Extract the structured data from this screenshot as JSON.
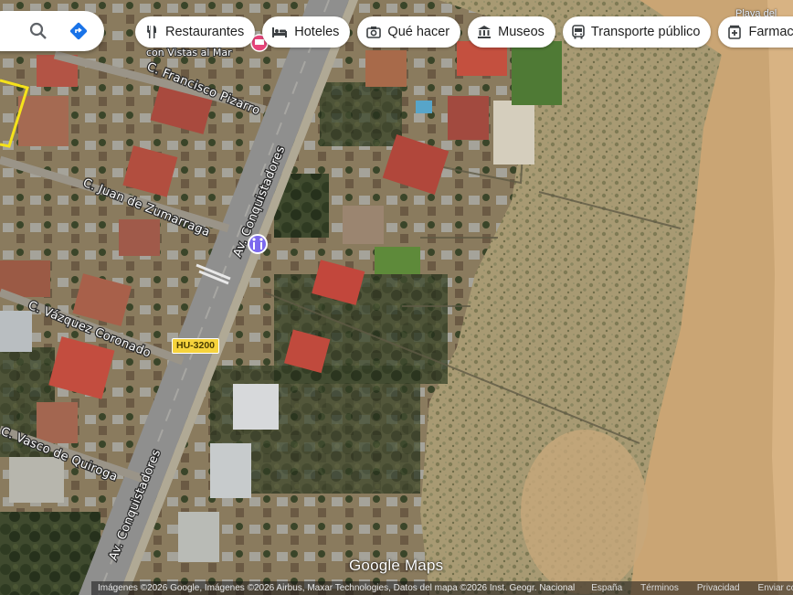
{
  "search": {
    "search_icon": "search-icon",
    "directions_icon": "directions-icon",
    "accent": "#1a73e8"
  },
  "chips": [
    {
      "label": "Restaurantes",
      "icon": "fork-knife-icon"
    },
    {
      "label": "Hoteles",
      "icon": "bed-icon"
    },
    {
      "label": "Qué hacer",
      "icon": "camera-icon"
    },
    {
      "label": "Museos",
      "icon": "museum-icon"
    },
    {
      "label": "Transporte público",
      "icon": "bus-icon"
    },
    {
      "label": "Farmacia",
      "icon": "pharmacy-icon"
    }
  ],
  "map": {
    "roads": {
      "conquistadores_1": "Av. Conquistadores",
      "conquistadores_2": "Av. Conquistadores",
      "pizarro": "C. Francisco Pizarro",
      "zumarraga": "C. Juan de Zumarraga",
      "vazquez": "C. Vázquez Coronado",
      "vasco": "C. Vasco de Quiroga"
    },
    "shield": "HU-3200",
    "poi_label": "con Vistas al Mar",
    "beach_label": "Playa del",
    "watermark": "Google Maps",
    "colors": {
      "road": "#8e8e8e",
      "shield": "#f6d33c",
      "sand": "#caa574",
      "selection": "#f5e21b"
    }
  },
  "footer": {
    "attribution": "Imágenes ©2026 Google, Imágenes ©2026 Airbus, Maxar Technologies, Datos del mapa ©2026 Inst. Geogr. Nacional",
    "country": "España",
    "terms": "Términos",
    "privacy": "Privacidad",
    "feedback": "Enviar comentarios"
  }
}
